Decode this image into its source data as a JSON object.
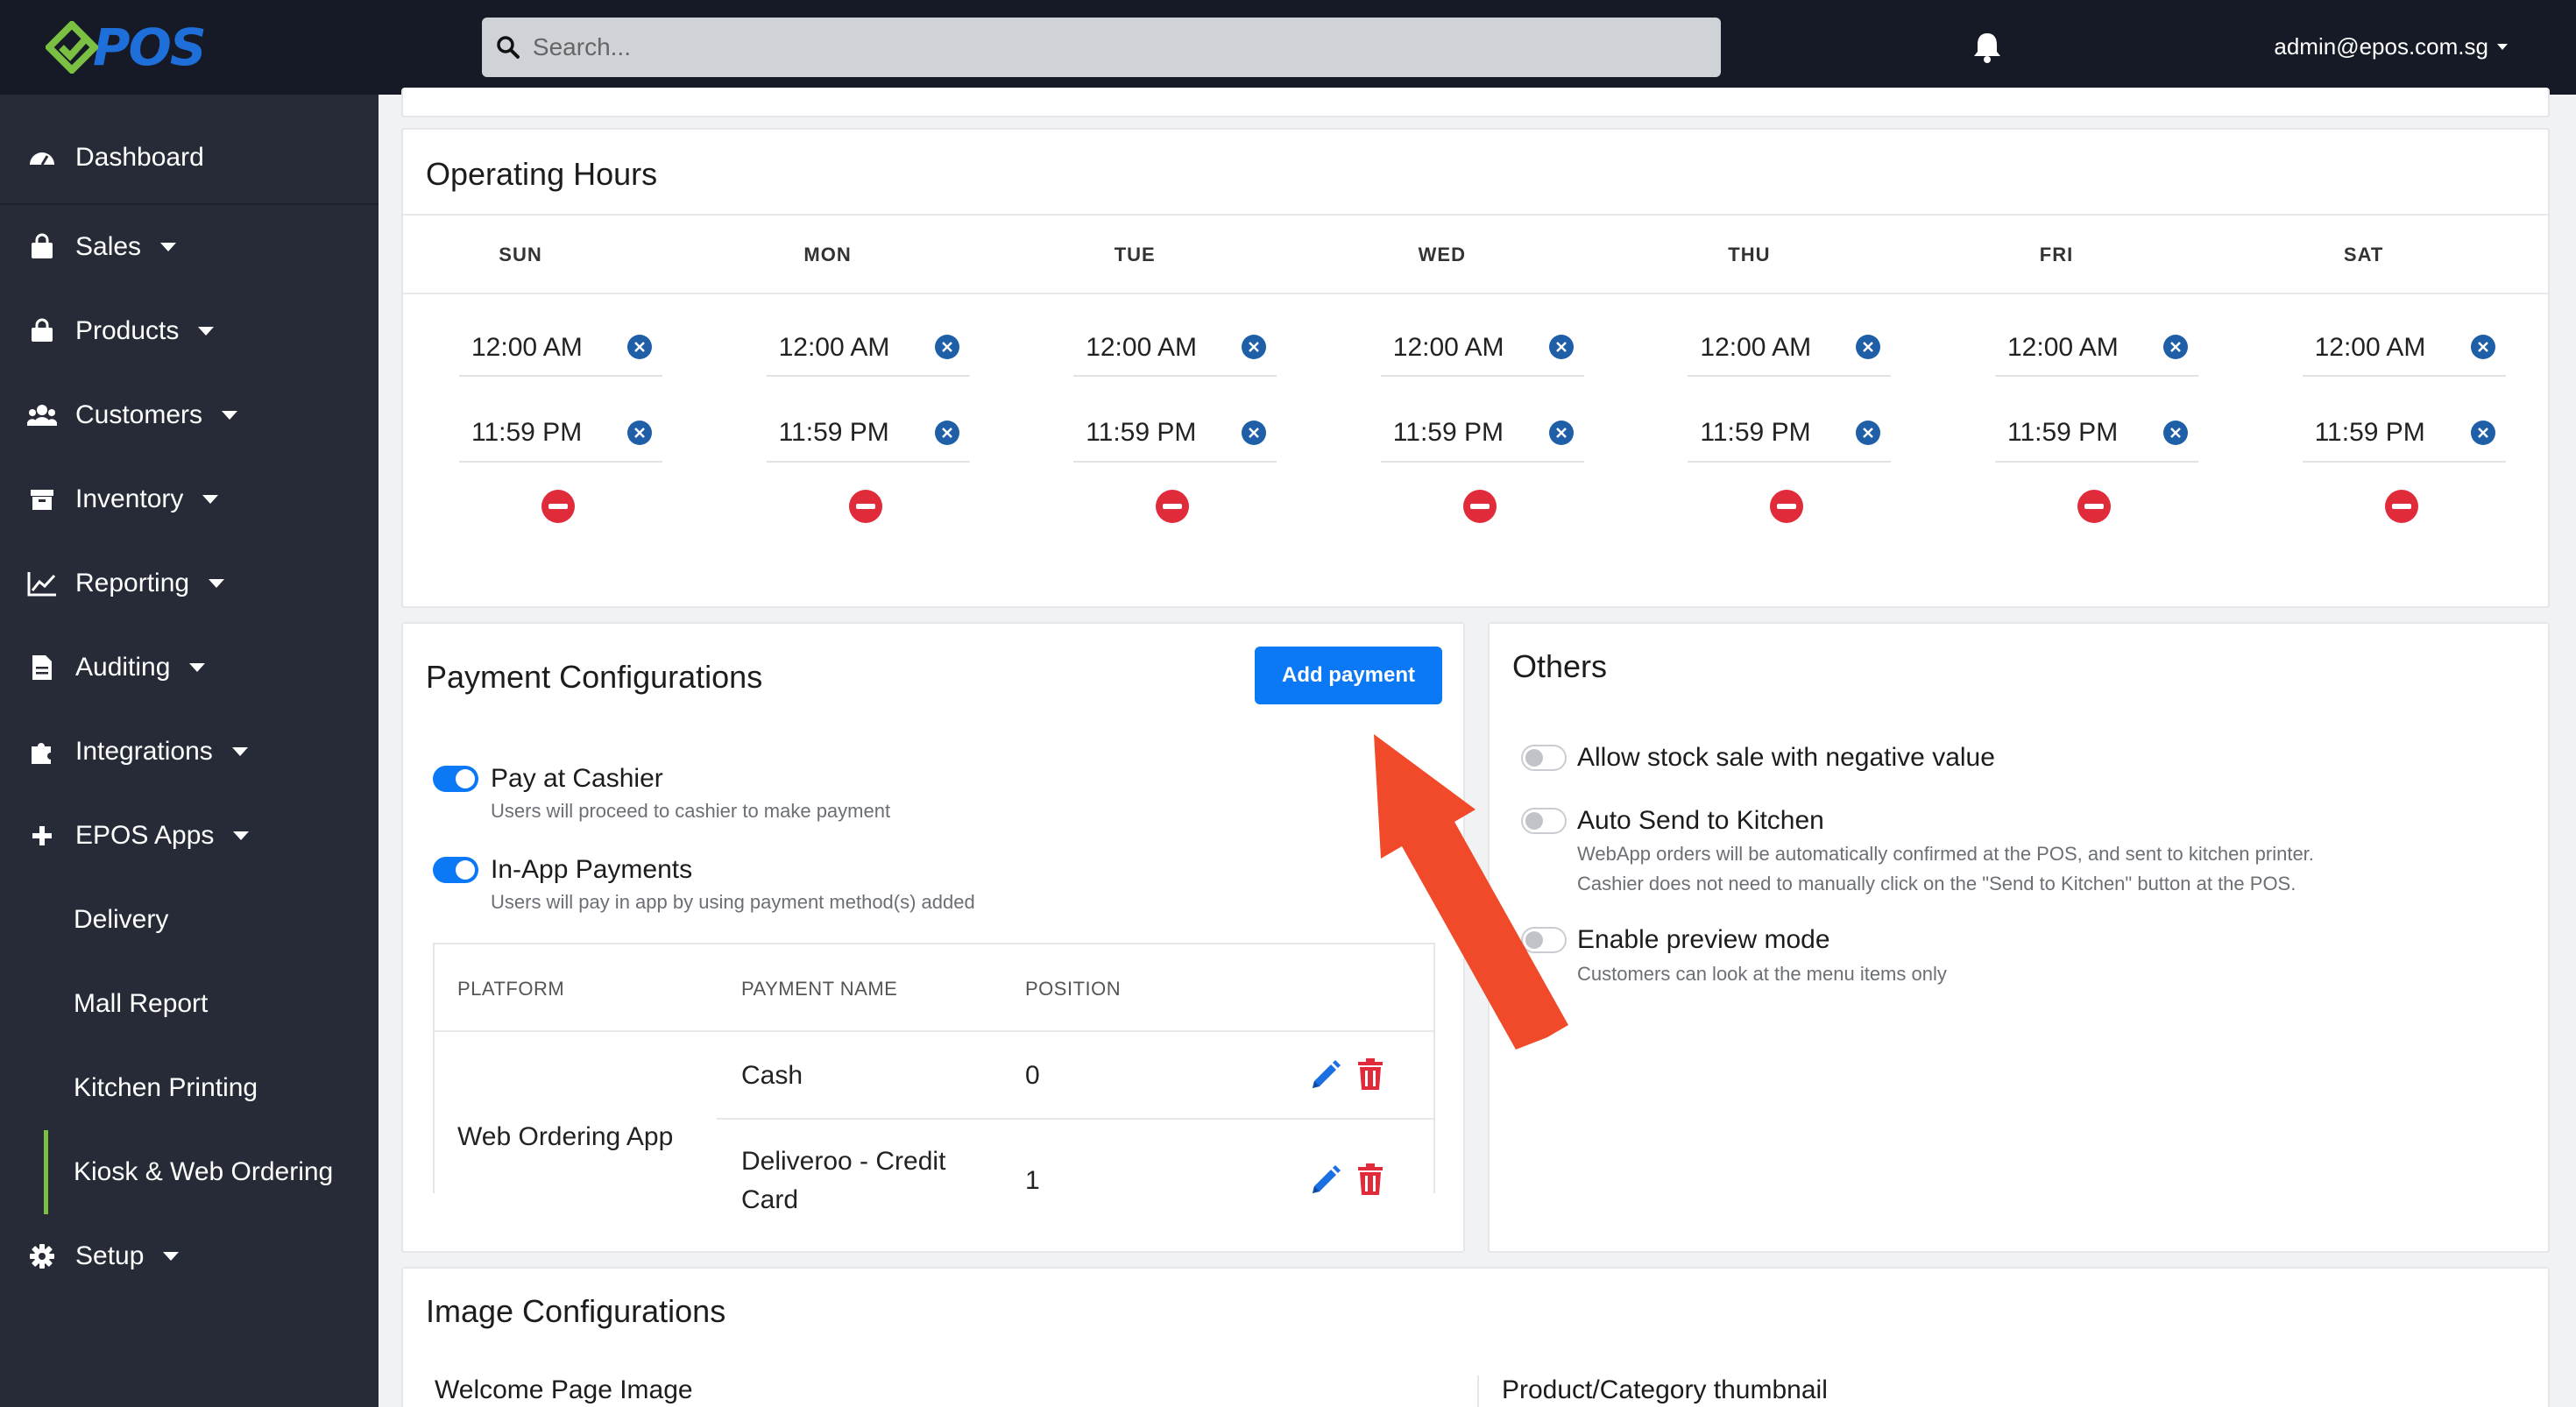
{
  "header": {
    "logo_text": "POS",
    "search_placeholder": "Search...",
    "user_email": "admin@epos.com.sg"
  },
  "sidebar": {
    "items": [
      {
        "label": "Dashboard",
        "icon": "dashboard-icon"
      },
      {
        "label": "Sales",
        "icon": "shopping-bag-icon"
      },
      {
        "label": "Products",
        "icon": "box-icon"
      },
      {
        "label": "Customers",
        "icon": "users-icon"
      },
      {
        "label": "Inventory",
        "icon": "archive-icon"
      },
      {
        "label": "Reporting",
        "icon": "chart-line-icon"
      },
      {
        "label": "Auditing",
        "icon": "file-icon"
      },
      {
        "label": "Integrations",
        "icon": "puzzle-icon"
      },
      {
        "label": "EPOS Apps",
        "icon": "plus-icon"
      },
      {
        "label": "Delivery"
      },
      {
        "label": "Mall Report"
      },
      {
        "label": "Kitchen Printing"
      },
      {
        "label": "Kiosk & Web Ordering"
      },
      {
        "label": "Setup",
        "icon": "gear-icon"
      }
    ]
  },
  "operating_hours": {
    "title": "Operating Hours",
    "days": [
      {
        "name": "SUN",
        "open": "12:00 AM",
        "close": "11:59 PM"
      },
      {
        "name": "MON",
        "open": "12:00 AM",
        "close": "11:59 PM"
      },
      {
        "name": "TUE",
        "open": "12:00 AM",
        "close": "11:59 PM"
      },
      {
        "name": "WED",
        "open": "12:00 AM",
        "close": "11:59 PM"
      },
      {
        "name": "THU",
        "open": "12:00 AM",
        "close": "11:59 PM"
      },
      {
        "name": "FRI",
        "open": "12:00 AM",
        "close": "11:59 PM"
      },
      {
        "name": "SAT",
        "open": "12:00 AM",
        "close": "11:59 PM"
      }
    ]
  },
  "payment": {
    "title": "Payment Configurations",
    "add_label": "Add payment",
    "options": [
      {
        "label": "Pay at Cashier",
        "desc": "Users will proceed to cashier to make payment",
        "on": true
      },
      {
        "label": "In-App Payments",
        "desc": "Users will pay in app by using payment method(s) added",
        "on": true
      }
    ],
    "columns": [
      "PLATFORM",
      "PAYMENT NAME",
      "POSITION"
    ],
    "platform": "Web Ordering App",
    "rows": [
      {
        "name": "Cash",
        "position": "0"
      },
      {
        "name_line1": "Deliveroo - Credit",
        "name_line2": "Card",
        "position": "1"
      }
    ]
  },
  "others": {
    "title": "Others",
    "options": [
      {
        "label": "Allow stock sale with negative value",
        "on": false
      },
      {
        "label": "Auto Send to Kitchen",
        "desc1": "WebApp orders will be automatically confirmed at the POS, and sent to kitchen printer.",
        "desc2": "Cashier does not need to manually click on the \"Send to Kitchen\" button at the POS.",
        "on": false
      },
      {
        "label": "Enable preview mode",
        "desc1": "Customers can look at the menu items only",
        "on": false
      }
    ]
  },
  "image_config": {
    "title": "Image Configurations",
    "welcome_label": "Welcome Page Image",
    "thumbnail_label": "Product/Category thumbnail"
  },
  "colors": {
    "accent": "#0b78f5",
    "danger": "#e02b3a",
    "sidebar_bg": "#262b37",
    "topbar_bg": "#151a26",
    "active_indicator": "#7bc043",
    "annotation_arrow": "#f04a2a"
  }
}
